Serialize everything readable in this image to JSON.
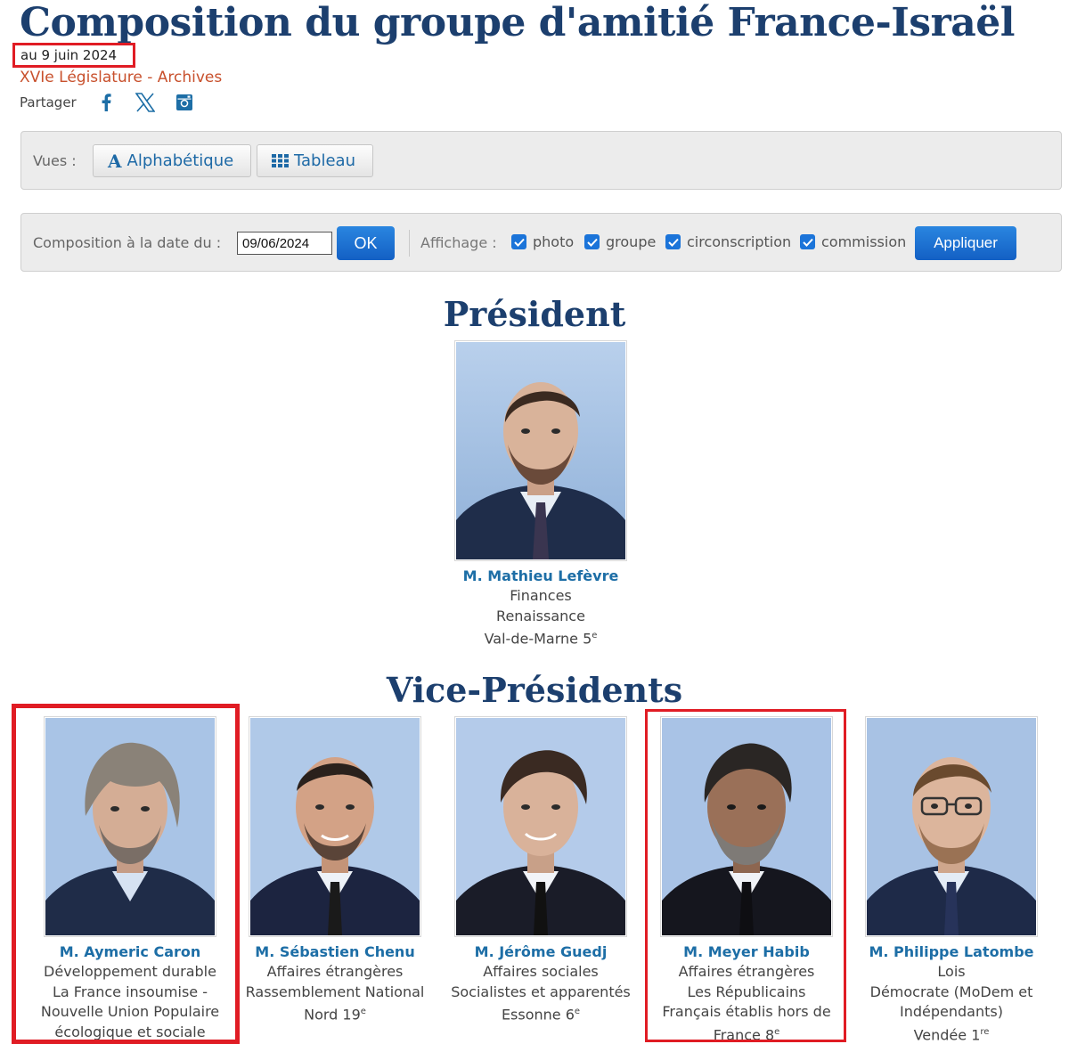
{
  "page": {
    "title": "Composition du groupe d'amitié France-Israël",
    "date": "au 9 juin 2024",
    "legislature": "XVIe Législature - Archives"
  },
  "share": {
    "label": "Partager",
    "icons": [
      "facebook-icon",
      "x-icon",
      "instagram-icon"
    ]
  },
  "views": {
    "label": "Vues :",
    "alpha_label": "Alphabétique",
    "table_label": "Tableau"
  },
  "composition": {
    "label": "Composition à la date du :",
    "date_value": "09/06/2024",
    "ok_label": "OK",
    "display_label": "Affichage :",
    "options": [
      {
        "label": "photo",
        "checked": true
      },
      {
        "label": "groupe",
        "checked": true
      },
      {
        "label": "circonscription",
        "checked": true
      },
      {
        "label": "commission",
        "checked": true
      }
    ],
    "apply_label": "Appliquer"
  },
  "colors": {
    "title": "#1c3f6e",
    "link": "#1d6ea6",
    "primary_button": "#1b6fd1",
    "highlight": "#e01c24",
    "legislature": "#c8502c"
  },
  "president": {
    "heading": "Président",
    "member": {
      "name": "M. Mathieu Lefèvre",
      "commission": "Finances",
      "group": "Renaissance",
      "circ": "Val-de-Marne 5",
      "circ_sup": "e"
    }
  },
  "vice_presidents": {
    "heading": "Vice-Présidents",
    "members": [
      {
        "name": "M. Aymeric Caron",
        "commission": "Développement durable",
        "group_l1": "La France insoumise -",
        "group_l2": "Nouvelle Union Populaire",
        "group_l3": "écologique et sociale",
        "highlighted": true
      },
      {
        "name": "M. Sébastien Chenu",
        "commission": "Affaires étrangères",
        "group": "Rassemblement National",
        "circ": "Nord 19",
        "circ_sup": "e",
        "highlighted": false
      },
      {
        "name": "M. Jérôme Guedj",
        "commission": "Affaires sociales",
        "group": "Socialistes et apparentés",
        "circ": "Essonne 6",
        "circ_sup": "e",
        "highlighted": false
      },
      {
        "name": "M. Meyer Habib",
        "commission": "Affaires étrangères",
        "group": "Les Républicains",
        "circ_l1": "Français établis hors de",
        "circ": "France 8",
        "circ_sup": "e",
        "highlighted": true
      },
      {
        "name": "M. Philippe Latombe",
        "commission": "Lois",
        "group_l1": "Démocrate (MoDem et",
        "group_l2": "Indépendants)",
        "circ": "Vendée 1",
        "circ_sup": "re",
        "highlighted": false
      }
    ]
  }
}
